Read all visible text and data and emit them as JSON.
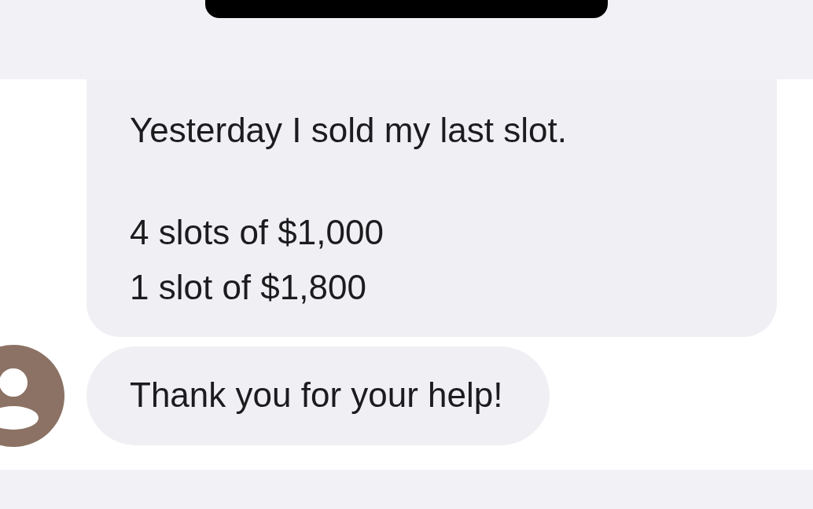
{
  "messages": [
    {
      "paragraphs": [
        [
          "Yesterday I sold my last slot."
        ],
        [
          "4 slots of $1,000",
          "1 slot of $1,800"
        ]
      ],
      "show_avatar": false
    },
    {
      "paragraphs": [
        [
          "Thank you for your help!"
        ]
      ],
      "show_avatar": true
    }
  ]
}
